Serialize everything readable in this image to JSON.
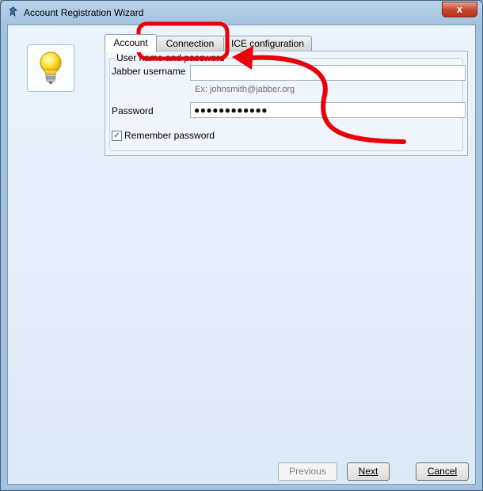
{
  "window": {
    "title": "Account Registration Wizard",
    "close_glyph": "x"
  },
  "tabs": [
    {
      "label": "Account",
      "active": true
    },
    {
      "label": "Connection",
      "active": false
    },
    {
      "label": "ICE configuration",
      "active": false
    }
  ],
  "group": {
    "legend": "User name and password"
  },
  "form": {
    "username_label": "Jabber username",
    "username_value": "",
    "username_hint": "Ex: johnsmith@jabber.org",
    "password_label": "Password",
    "password_value": "●●●●●●●●●●●●",
    "remember_label": "Remember password",
    "remember_checked": true
  },
  "buttons": {
    "previous": "Previous",
    "next": "Next",
    "cancel": "Cancel"
  },
  "annotation": {
    "color": "#e8000b"
  },
  "icons": [
    "app-icon",
    "lightbulb-icon",
    "close-icon",
    "check-icon"
  ]
}
